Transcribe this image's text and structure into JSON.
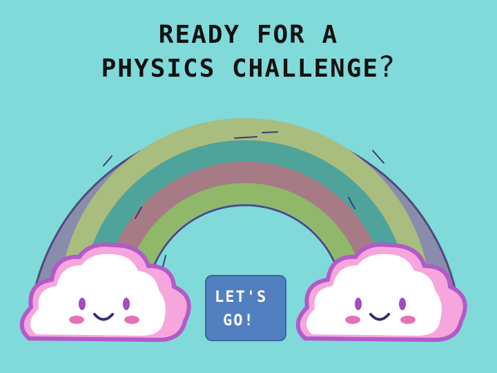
{
  "title": {
    "line1": "READY FOR A",
    "line2": "PHYSICS CHALLENGE",
    "question_mark": "?"
  },
  "button": {
    "line1": "LET'S",
    "line2": "GO!"
  },
  "colors": {
    "background": "#80dad9",
    "button": "#527fbf",
    "arc_outer": "#8a8cac",
    "arc_yellow": "#a8bd7e",
    "arc_teal": "#4ea39a",
    "arc_red": "#a67b86",
    "arc_green": "#8fb868",
    "cloud_outline": "#b25ac8",
    "cloud_pink": "#f6a6dc"
  },
  "icons": [
    "rainbow-icon",
    "cloud-icon",
    "cloud-icon"
  ]
}
